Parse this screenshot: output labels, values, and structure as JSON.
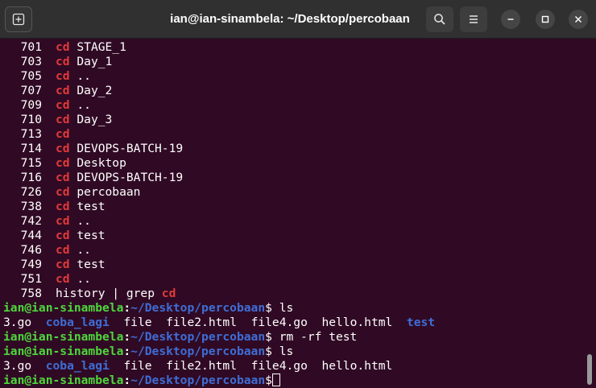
{
  "window": {
    "title": "ian@ian-sinambela: ~/Desktop/percobaan"
  },
  "prompt": {
    "user_host": "ian@ian-sinambela",
    "colon": ":",
    "path": "~/Desktop/percobaan",
    "dollar": "$"
  },
  "history": [
    {
      "num": "701",
      "cmd": "cd",
      "arg": "STAGE_1"
    },
    {
      "num": "703",
      "cmd": "cd",
      "arg": "Day_1"
    },
    {
      "num": "705",
      "cmd": "cd",
      "arg": ".."
    },
    {
      "num": "707",
      "cmd": "cd",
      "arg": "Day_2"
    },
    {
      "num": "709",
      "cmd": "cd",
      "arg": ".."
    },
    {
      "num": "710",
      "cmd": "cd",
      "arg": "Day_3"
    },
    {
      "num": "713",
      "cmd": "cd",
      "arg": ""
    },
    {
      "num": "714",
      "cmd": "cd",
      "arg": "DEVOPS-BATCH-19"
    },
    {
      "num": "715",
      "cmd": "cd",
      "arg": "Desktop"
    },
    {
      "num": "716",
      "cmd": "cd",
      "arg": "DEVOPS-BATCH-19"
    },
    {
      "num": "726",
      "cmd": "cd",
      "arg": "percobaan"
    },
    {
      "num": "738",
      "cmd": "cd",
      "arg": "test"
    },
    {
      "num": "742",
      "cmd": "cd",
      "arg": ".."
    },
    {
      "num": "744",
      "cmd": "cd",
      "arg": "test"
    },
    {
      "num": "746",
      "cmd": "cd",
      "arg": ".."
    },
    {
      "num": "749",
      "cmd": "cd",
      "arg": "test"
    },
    {
      "num": "751",
      "cmd": "cd",
      "arg": ".."
    }
  ],
  "history_last": {
    "num": "758",
    "text": "history | grep ",
    "match": "cd"
  },
  "commands": {
    "ls1": " ls",
    "rm": " rm -rf test",
    "ls2": " ls"
  },
  "ls_output_1": {
    "f1": "3.go",
    "d1": "coba_lagi",
    "f2": "file",
    "f3": "file2.html",
    "f4": "file4.go",
    "f5": "hello.html",
    "d2": "test"
  },
  "ls_output_2": {
    "f1": "3.go",
    "d1": "coba_lagi",
    "f2": "file",
    "f3": "file2.html",
    "f4": "file4.go",
    "f5": "hello.html"
  },
  "colors": {
    "terminal_bg": "#300a24",
    "prompt_user": "#4ed63c",
    "prompt_path": "#3f6dd6",
    "grep_match": "#e23a3a"
  }
}
